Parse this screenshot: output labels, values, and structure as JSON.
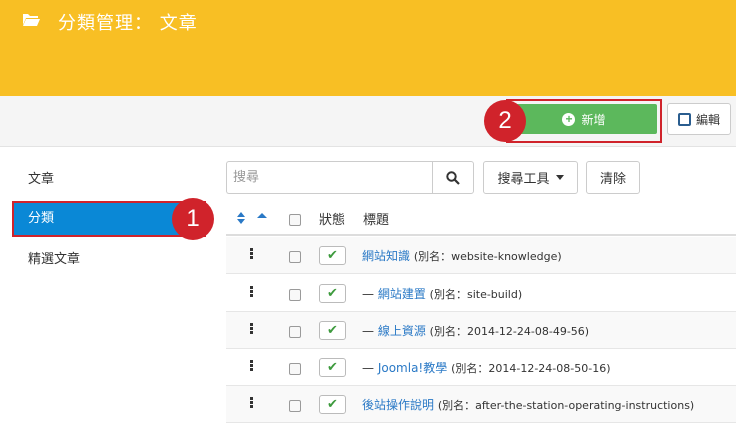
{
  "header": {
    "title": "分類管理： 文章",
    "icon": "folder-open-icon",
    "background": "#f8bf24"
  },
  "toolbar": {
    "new_label": "新增",
    "edit_label": "編輯"
  },
  "annotations": {
    "badge_1": "1",
    "badge_2": "2"
  },
  "sidebar": {
    "items": [
      {
        "label": "文章"
      },
      {
        "label": "分類"
      },
      {
        "label": "精選文章"
      }
    ]
  },
  "filters": {
    "search_placeholder": "搜尋",
    "tools_label": "搜尋工具",
    "clear_label": "清除"
  },
  "table": {
    "headers": {
      "status": "狀態",
      "title": "標題"
    },
    "rows": [
      {
        "prefix": "",
        "title": "網站知識",
        "alias": "(別名：website-knowledge)"
      },
      {
        "prefix": "— ",
        "title": "網站建置",
        "alias": "(別名：site-build)"
      },
      {
        "prefix": "— ",
        "title": "線上資源",
        "alias": "(別名：2014-12-24-08-49-56)"
      },
      {
        "prefix": "— ",
        "title": "Joomla!教學",
        "alias": "(別名：2014-12-24-08-50-16)"
      },
      {
        "prefix": "",
        "title": "後站操作說明",
        "alias": "(別名：after-the-station-operating-instructions)"
      }
    ]
  },
  "colors": {
    "accent_blue": "#0a88d6",
    "success_green": "#5cb85c",
    "annotation_red": "#d0232b",
    "link_blue": "#2a79c6"
  }
}
